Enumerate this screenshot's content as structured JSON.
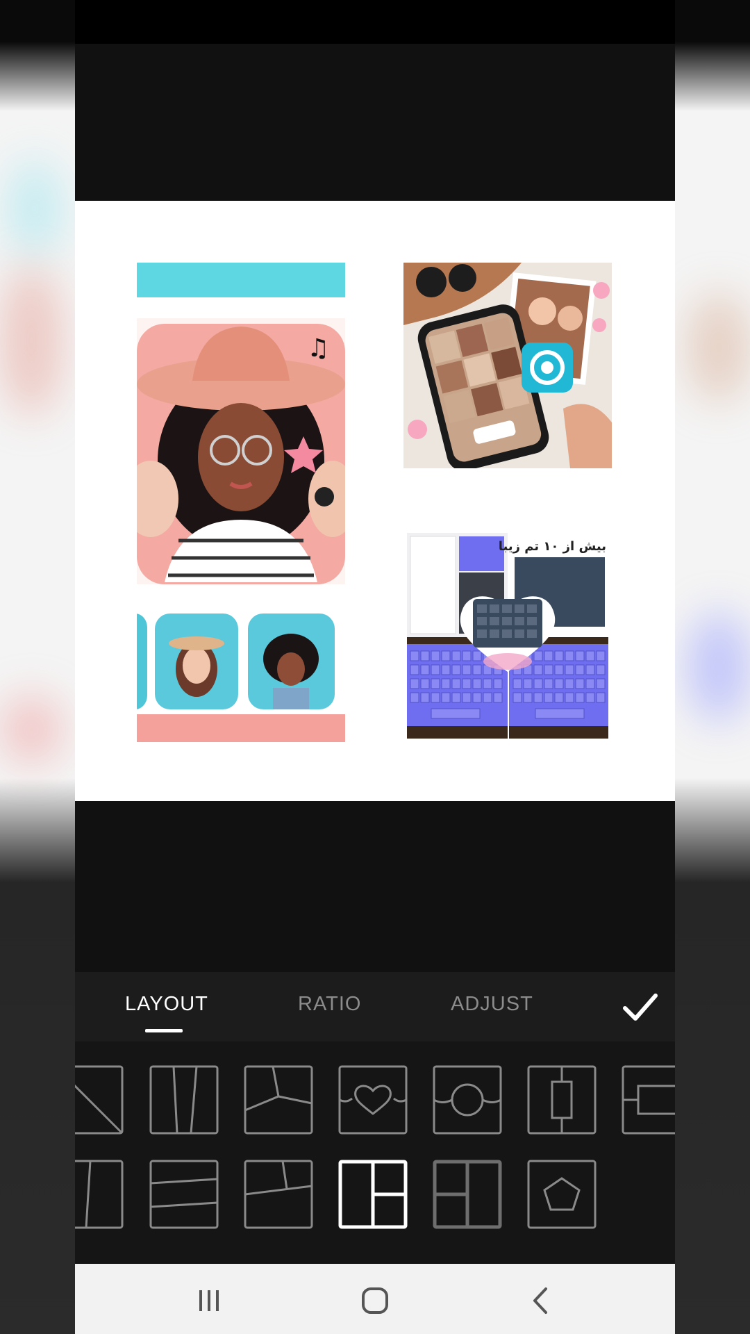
{
  "app": {
    "tabs": [
      {
        "label": "LAYOUT",
        "active": true
      },
      {
        "label": "RATIO",
        "active": false
      },
      {
        "label": "ADJUST",
        "active": false
      }
    ],
    "confirm_icon": "check-icon"
  },
  "canvas": {
    "photos": [
      {
        "name": "girls-hat-illustration",
        "description_icon": "photo"
      },
      {
        "name": "phone-collage-photo",
        "description_icon": "photo"
      },
      {
        "name": "keyboard-themes-photo",
        "description_icon": "photo",
        "overlay_text": "بیش از ۱۰ تم زیبا"
      }
    ]
  },
  "layouts": {
    "row1": [
      "diagonal-split",
      "three-columns-slanted",
      "three-panels-angled",
      "heart-cutout",
      "circle-cutout",
      "vertical-center-rect",
      "horizontal-center-rect"
    ],
    "row2": [
      "two-columns-slanted",
      "three-rows-slanted",
      "three-panels-slanted",
      "left-column-right-two-rows",
      "left-column-right-two-rows-alt",
      "pentagon-center"
    ],
    "selected": "left-column-right-two-rows"
  },
  "navbar": {
    "recents_icon": "recents-icon",
    "home_icon": "home-icon",
    "back_icon": "back-icon"
  },
  "colors": {
    "background": "#111111",
    "panel": "#1c1c1c",
    "tab_active": "#ffffff",
    "tab_inactive": "#8c8c8c",
    "layout_stroke": "#8a8a8a",
    "keyboard_purple": "#6f6ef0"
  }
}
